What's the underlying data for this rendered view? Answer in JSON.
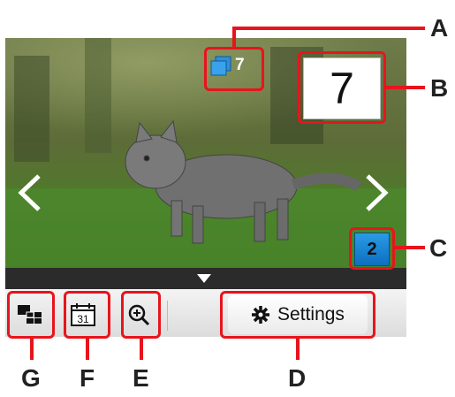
{
  "photo": {
    "subject": "kitten-photo",
    "total_count": "7",
    "copies": "7",
    "sheet_indicator": "2"
  },
  "toolbar": {
    "layout_button_icon": "layout-grid-icon",
    "date_button_icon": "calendar-icon",
    "date_icon_text": "31",
    "zoom_button_icon": "zoom-in-icon",
    "settings_label": "Settings",
    "settings_icon": "gear-icon"
  },
  "callouts": {
    "a": "A",
    "b": "B",
    "c": "C",
    "d": "D",
    "e": "E",
    "f": "F",
    "g": "G"
  },
  "colors": {
    "highlight": "#e8141c",
    "badge_blue": "#1a86d8"
  }
}
